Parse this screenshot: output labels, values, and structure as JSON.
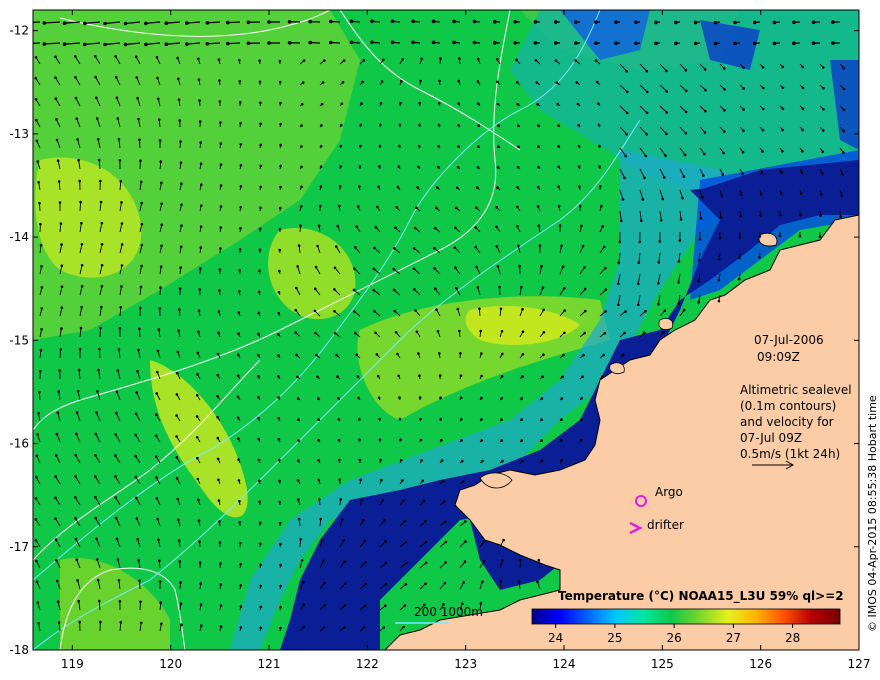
{
  "map": {
    "lon_range": [
      118.6,
      127.0
    ],
    "lat_range": [
      -18.0,
      -11.8
    ],
    "lon_ticks": [
      "119",
      "120",
      "121",
      "122",
      "123",
      "124",
      "125",
      "126",
      "127"
    ],
    "lat_ticks": [
      "-12",
      "-13",
      "-14",
      "-15",
      "-16",
      "-17",
      "-18"
    ],
    "colors": {
      "land": "#fbcca6",
      "cold_water": "#00148c",
      "cool_water": "#1e90e6",
      "mid_water": "#10c848",
      "warm_water": "#7cd62a",
      "hot_water": "#d8ea1c",
      "contour_white": "#ffffff",
      "contour_cyan": "#7fe8ff",
      "arrow": "#000000"
    }
  },
  "annotations": {
    "date": "07-Jul-2006",
    "time": "09:09Z",
    "legend_lines": [
      "Altimetric sealevel",
      "(0.1m contours)",
      "and velocity for",
      "07-Jul 09Z",
      "0.5m/s (1kt 24h)"
    ],
    "argo_label": "Argo",
    "drifter_label": "drifter",
    "depth_scale": "200  1000m",
    "credit": "© IMOS 04-Apr-2015 08:55:38 Hobart time"
  },
  "colorbar": {
    "title": "Temperature (°C) NOAA15_L3U 59% ql>=2",
    "ticks": [
      "24",
      "25",
      "26",
      "27",
      "28"
    ],
    "range": [
      23.6,
      28.8
    ],
    "stops": [
      "#00008c",
      "#0000ff",
      "#0064ff",
      "#00c8ff",
      "#00e6a0",
      "#10c848",
      "#7cd62a",
      "#e6f01e",
      "#ffb400",
      "#ff5000",
      "#b40000",
      "#780000"
    ]
  }
}
